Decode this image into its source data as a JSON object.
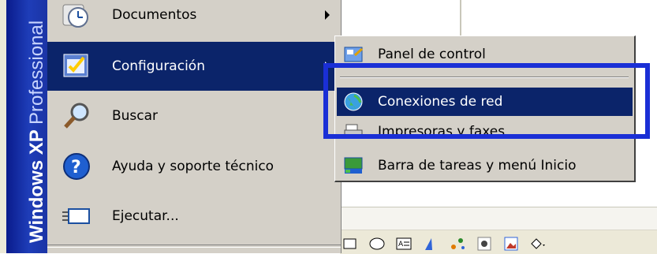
{
  "banner": {
    "product": "Windows XP",
    "edition": "Professional"
  },
  "start_menu": {
    "items": [
      {
        "label": "Documentos",
        "icon": "documents-clock-icon",
        "has_submenu": true
      },
      {
        "label": "Configuración",
        "icon": "settings-check-icon",
        "has_submenu": true,
        "selected": true
      },
      {
        "label": "Buscar",
        "icon": "magnifier-icon"
      },
      {
        "label": "Ayuda y soporte técnico",
        "icon": "help-icon"
      },
      {
        "label": "Ejecutar...",
        "icon": "run-icon"
      }
    ]
  },
  "submenu": {
    "items": [
      {
        "label": "Panel de control",
        "icon": "control-panel-icon"
      },
      {
        "label": "Conexiones de red",
        "icon": "network-globe-icon",
        "selected": true
      },
      {
        "label": "Impresoras y faxes",
        "icon": "printer-icon"
      },
      {
        "label": "Barra de tareas y menú Inicio",
        "icon": "taskbar-icon"
      }
    ]
  },
  "colors": {
    "selection": "#0b246a",
    "menu_bg": "#d4d0c8",
    "banner": "#1e3db8",
    "annotation": "#1a2fd6"
  }
}
